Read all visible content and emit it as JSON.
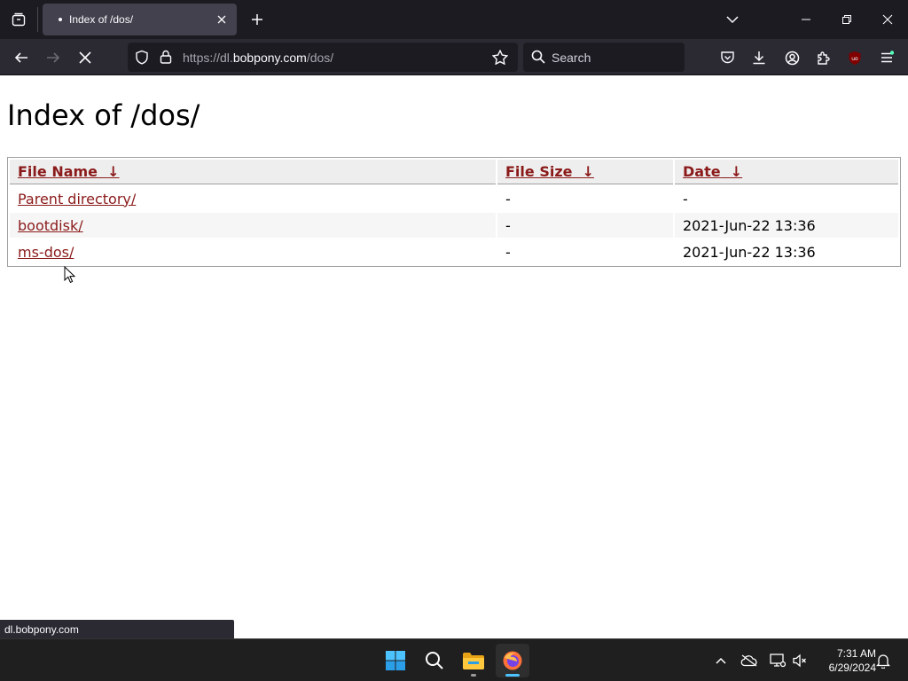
{
  "browser": {
    "tab_title": "Index of /dos/",
    "url_prefix": "https://dl.",
    "url_host": "bobpony.com",
    "url_path": "/dos/",
    "search_placeholder": "Search",
    "status_text": "dl.bobpony.com"
  },
  "page": {
    "heading": "Index of /dos/",
    "columns": [
      {
        "label": "File Name",
        "sort": "↓"
      },
      {
        "label": "File Size",
        "sort": "↓"
      },
      {
        "label": "Date",
        "sort": "↓"
      }
    ],
    "rows": [
      {
        "name": "Parent directory/",
        "size": "-",
        "date": "-"
      },
      {
        "name": "bootdisk/",
        "size": "-",
        "date": "2021-Jun-22 13:36"
      },
      {
        "name": "ms-dos/",
        "size": "-",
        "date": "2021-Jun-22 13:36"
      }
    ]
  },
  "taskbar": {
    "time": "7:31 AM",
    "date": "6/29/2024"
  },
  "colors": {
    "link": "#8b1a1a",
    "chrome_dark": "#1c1b22",
    "chrome_toolbar": "#2b2a33",
    "firefox_indicator": "#4cc2ff"
  }
}
